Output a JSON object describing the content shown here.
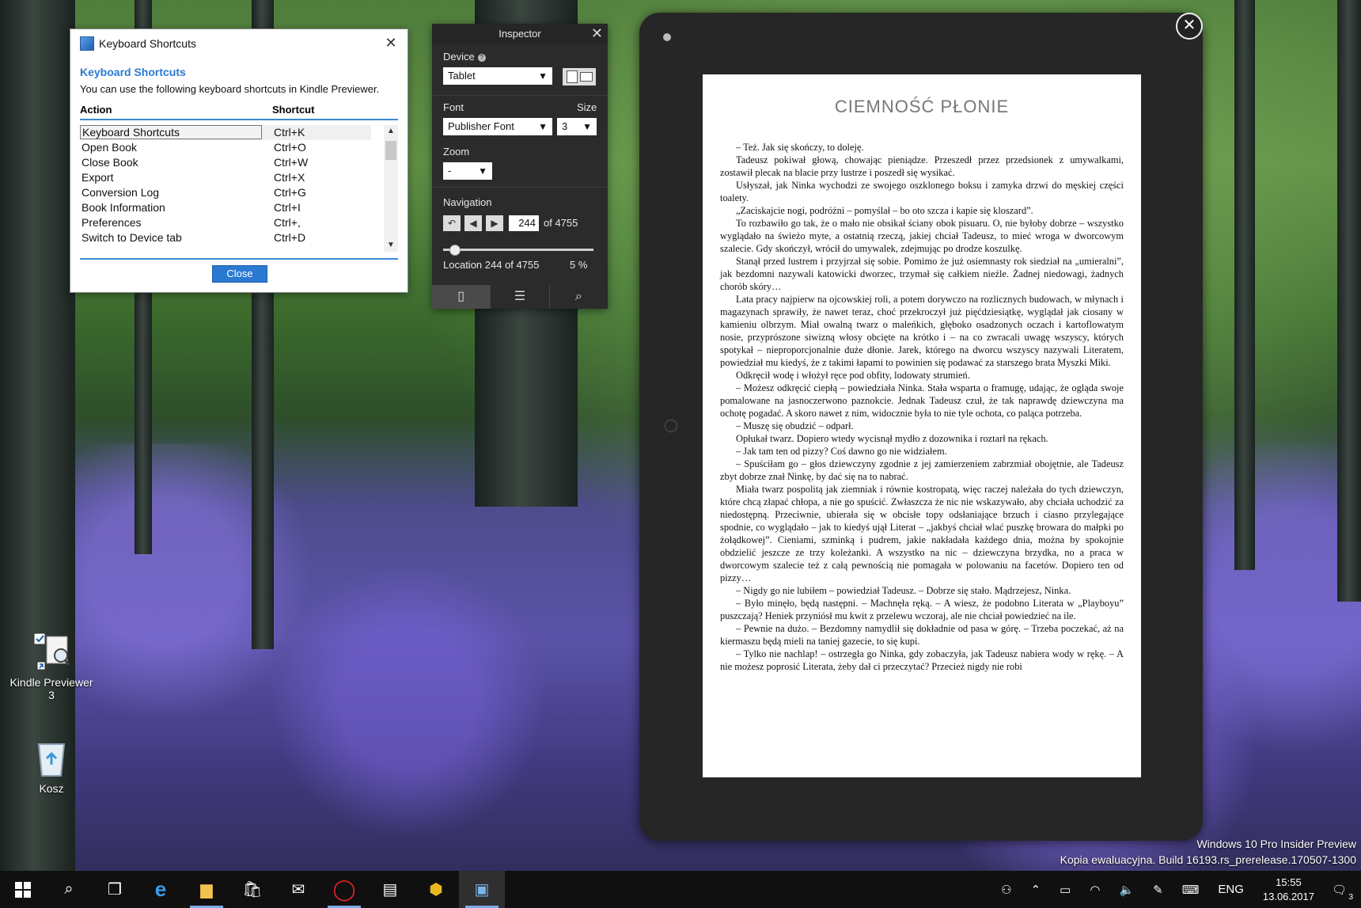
{
  "dialog": {
    "title": "Keyboard Shortcuts",
    "heading": "Keyboard Shortcuts",
    "description": "You can use the following keyboard shortcuts in Kindle Previewer.",
    "col_action": "Action",
    "col_shortcut": "Shortcut",
    "rows": [
      {
        "action": "Keyboard Shortcuts",
        "shortcut": "Ctrl+K"
      },
      {
        "action": "Open Book",
        "shortcut": "Ctrl+O"
      },
      {
        "action": "Close Book",
        "shortcut": "Ctrl+W"
      },
      {
        "action": "Export",
        "shortcut": "Ctrl+X"
      },
      {
        "action": "Conversion Log",
        "shortcut": "Ctrl+G"
      },
      {
        "action": "Book Information",
        "shortcut": "Ctrl+I"
      },
      {
        "action": "Preferences",
        "shortcut": "Ctrl+,"
      },
      {
        "action": "Switch to Device tab",
        "shortcut": "Ctrl+D"
      }
    ],
    "close_label": "Close"
  },
  "inspector": {
    "title": "Inspector",
    "device_label": "Device",
    "device_value": "Tablet",
    "font_label": "Font",
    "font_value": "Publisher Font",
    "size_label": "Size",
    "size_value": "3",
    "zoom_label": "Zoom",
    "zoom_value": "-",
    "navigation_label": "Navigation",
    "page_value": "244",
    "of_total": "of 4755",
    "location_text": "Location 244 of 4755",
    "percent_text": "5 %",
    "progress_fraction": 0.05
  },
  "book": {
    "title": "CIEMNOŚĆ PŁONIE",
    "paragraphs": [
      "– Też. Jak się skończy, to doleję.",
      "Tadeusz pokiwał głową, chowając pieniądze. Przeszedł przez przedsionek z umywalkami, zostawił plecak na blacie przy lustrze i poszedł się wysikać.",
      "Usłyszał, jak Ninka wychodzi ze swojego oszklonego boksu i zamyka drzwi do męskiej części toalety.",
      "„Zaciskajcie nogi, podróżni – pomyślał – bo oto szcza i kapie się kloszard”.",
      "To rozbawiło go tak, że o mało nie obsikał ściany obok pisuaru. O, nie byłoby dobrze – wszystko wyglądało na świeżo myte, a ostatnią rzeczą, jakiej chciał Tadeusz, to mieć wroga w dworcowym szalecie. Gdy skończył, wrócił do umywalek, zdejmując po drodze koszulkę.",
      "Stanął przed lustrem i przyjrzał się sobie. Pomimo że już osiemnasty rok siedział na „umieralni”, jak bezdomni nazywali katowicki dworzec, trzymał się całkiem nieźle. Żadnej niedowagi, żadnych chorób skóry…",
      "Lata pracy najpierw na ojcowskiej roli, a potem dorywczo na rozlicznych budowach, w młynach i magazynach sprawiły, że nawet teraz, choć przekroczył już pięćdziesiątkę, wyglądał jak ciosany w kamieniu olbrzym. Miał owalną twarz o maleńkich, głęboko osadzonych oczach i kartoflowatym nosie, przyprószone siwizną włosy obcięte na krótko i – na co zwracali uwagę wszyscy, których spotykał – nieproporcjonalnie duże dłonie. Jarek, którego na dworcu wszyscy nazywali Literatem, powiedział mu kiedyś, że z takimi łapami to powinien się podawać za starszego brata Myszki Miki.",
      "Odkręcił wodę i włożył ręce pod obfity, lodowaty strumień.",
      "– Możesz odkręcić ciepłą – powiedziała Ninka. Stała wsparta o framugę, udając, że ogląda swoje pomalowane na jasnoczerwono paznokcie. Jednak Tadeusz czuł, że tak naprawdę dziewczyna ma ochotę pogadać. A skoro nawet z nim, widocznie była to nie tyle ochota, co paląca potrzeba.",
      "– Muszę się obudzić – odparł.",
      "Opłukał twarz. Dopiero wtedy wycisnął mydło z dozownika i roztarł na rękach.",
      "– Jak tam ten od pizzy? Coś dawno go nie widziałem.",
      "– Spuściłam go – głos dziewczyny zgodnie z jej zamierzeniem zabrzmiał obojętnie, ale Tadeusz zbyt dobrze znał Ninkę, by dać się na to nabrać.",
      "Miała twarz pospolitą jak ziemniak i równie kostropatą, więc raczej należała do tych dziewczyn, które chcą złapać chłopa, a nie go spuścić. Zwłaszcza że nic nie wskazywało, aby chciała uchodzić za niedostępną. Przeciwnie, ubierała się w obcisłe topy odsłaniające brzuch i ciasno przylegające spodnie, co wyglądało – jak to kiedyś ujął Literat – „jakbyś chciał wlać puszkę browara do małpki po żołądkowej”. Cieniami, szminką i pudrem, jakie nakładała każdego dnia, można by spokojnie obdzielić jeszcze ze trzy koleżanki. A wszystko na nic – dziewczyna brzydka, no a praca w dworcowym szalecie też z całą pewnością nie pomagała w polowaniu na facetów. Dopiero ten od pizzy…",
      "– Nigdy go nie lubiłem – powiedział Tadeusz. – Dobrze się stało. Mądrzejesz, Ninka.",
      "– Było minęło, będą następni. – Machnęła ręką. – A wiesz, że podobno Literata w „Playboyu” puszczają? Heniek przyniósł mu kwit z przelewu wczoraj, ale nie chciał powiedzieć na ile.",
      "– Pewnie na dużo. – Bezdomny namydlił się dokładnie od pasa w górę. – Trzeba poczekać, aż na kiermaszu będą mieli na taniej gazecie, to się kupi.",
      "– Tylko nie nachlap! – ostrzegła go Ninka, gdy zobaczyła, jak Tadeusz nabiera wody w rękę. – A nie możesz poprosić Literata, żeby dał ci przeczytać? Przecież nigdy nie robi"
    ]
  },
  "desktop": {
    "icons": [
      {
        "label": "Kindle Previewer 3",
        "icon": "kindle-previewer-icon"
      },
      {
        "label": "Kosz",
        "icon": "recycle-bin-icon"
      }
    ],
    "watermark_line1": "Windows 10 Pro Insider Preview",
    "watermark_line2": "Kopia ewaluacyjna. Build 16193.rs_prerelease.170507-1300"
  },
  "taskbar": {
    "language": "ENG",
    "time": "15:55",
    "date": "13.06.2017",
    "notification_count": "3"
  },
  "colors": {
    "accent": "#2a7ad2",
    "inspector_bg": "#2b2b2b",
    "tablet_bezel": "#262626",
    "taskbar_bg": "#101010"
  }
}
